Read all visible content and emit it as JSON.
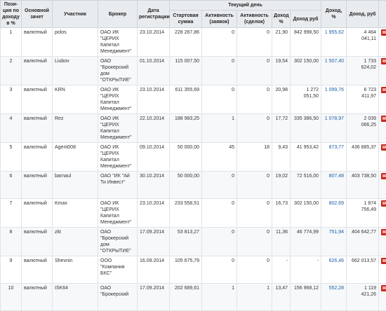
{
  "headers": {
    "position": "Пози-ция по доходу в %",
    "account": "Основной зачет",
    "participant": "Участник",
    "broker": "Брокер",
    "reg_date": "Дата регистрации",
    "current_day": "Текущий день",
    "start_sum": "Стартовая сумма",
    "activity_orders": "Активность (заявок)",
    "activity_deals": "Активность (сделок)",
    "day_income_pct": "Доход %",
    "day_income_rub": "Доход руб",
    "income_pct": "Доход, %",
    "income_rub": "Доход, руб"
  },
  "rows": [
    {
      "pos": "1",
      "acc": "валютный",
      "name": "polos",
      "broker": "ОАО ИК \"ЦЕРИХ Капитал Менеджмент\"",
      "date": "23.10.2014",
      "start": "228 267,86",
      "orders": "0",
      "deals": "0",
      "dpct": "21,90",
      "drub": "842 998,50",
      "pct": "1 955,62",
      "rub": "4 464 041,11"
    },
    {
      "pos": "2",
      "acc": "валютный",
      "name": "Liubov",
      "broker": "ОАО \"Брокерский дом \"ОТКРЫТИЕ\"",
      "date": "01.10.2014",
      "start": "115 007,50",
      "orders": "0",
      "deals": "0",
      "dpct": "19,54",
      "drub": "302 150,00",
      "pct": "1 507,40",
      "rub": "1 733 624,02"
    },
    {
      "pos": "3",
      "acc": "валютный",
      "name": "KRN",
      "broker": "ОАО ИК \"ЦЕРИХ Капитал Менеджмент\"",
      "date": "23.10.2014",
      "start": "611 355,69",
      "orders": "0",
      "deals": "0",
      "dpct": "20,98",
      "drub": "1 272 051,50",
      "pct": "1 099,76",
      "rub": "6 723 411,97"
    },
    {
      "pos": "4",
      "acc": "валютный",
      "name": "Rez",
      "broker": "ОАО ИК \"ЦЕРИХ Капитал Менеджмент\"",
      "date": "22.10.2014",
      "start": "188 983,25",
      "orders": "1",
      "deals": "0",
      "dpct": "17,72",
      "drub": "335 386,50",
      "pct": "1 078,97",
      "rub": "2 039 066,25"
    },
    {
      "pos": "5",
      "acc": "валютный",
      "name": "Agent008",
      "broker": "ОАО ИК \"ЦЕРИХ Капитал Менеджмент\"",
      "date": "09.10.2014",
      "start": "50 000,00",
      "orders": "45",
      "deals": "18",
      "dpct": "9,43",
      "drub": "41 953,42",
      "pct": "873,77",
      "rub": "436 885,37"
    },
    {
      "pos": "6",
      "acc": "валютный",
      "name": "barnaul",
      "broker": "ОАО \"ИК \"Ай Ти Инвест\"",
      "date": "30.10.2014",
      "start": "50 000,00",
      "orders": "0",
      "deals": "0",
      "dpct": "19,02",
      "drub": "72 516,00",
      "pct": "807,48",
      "rub": "403 738,50"
    },
    {
      "pos": "7",
      "acc": "валютный",
      "name": "Kmax",
      "broker": "ОАО ИК \"ЦЕРИХ Капитал Менеджмент\"",
      "date": "23.10.2014",
      "start": "233 558,51",
      "orders": "0",
      "deals": "0",
      "dpct": "16,73",
      "drub": "302 150,00",
      "pct": "802,69",
      "rub": "1 874 756,49"
    },
    {
      "pos": "8",
      "acc": "валютный",
      "name": "zkt",
      "broker": "ОАО \"Брокерский дом \"ОТКРЫТИЕ\"",
      "date": "17.09.2014",
      "start": "53 813,27",
      "orders": "0",
      "deals": "0",
      "dpct": "11,36",
      "drub": "46 774,99",
      "pct": "751,94",
      "rub": "404 642,77"
    },
    {
      "pos": "9",
      "acc": "валютный",
      "name": "Shevnin",
      "broker": "ООО \"Компания БКС\"",
      "date": "16.09.2014",
      "start": "105 675,79",
      "orders": "0",
      "deals": "0",
      "dpct": "-",
      "drub": "-",
      "pct": "626,46",
      "rub": "662 013,57"
    },
    {
      "pos": "10",
      "acc": "валютный",
      "name": "ISK64",
      "broker": "ОАО \"Брокерский",
      "date": "17.09.2014",
      "start": "202 689,61",
      "orders": "1",
      "deals": "1",
      "dpct": "13,47",
      "drub": "156 968,12",
      "pct": "552,28",
      "rub": "1 119 421,26"
    }
  ]
}
